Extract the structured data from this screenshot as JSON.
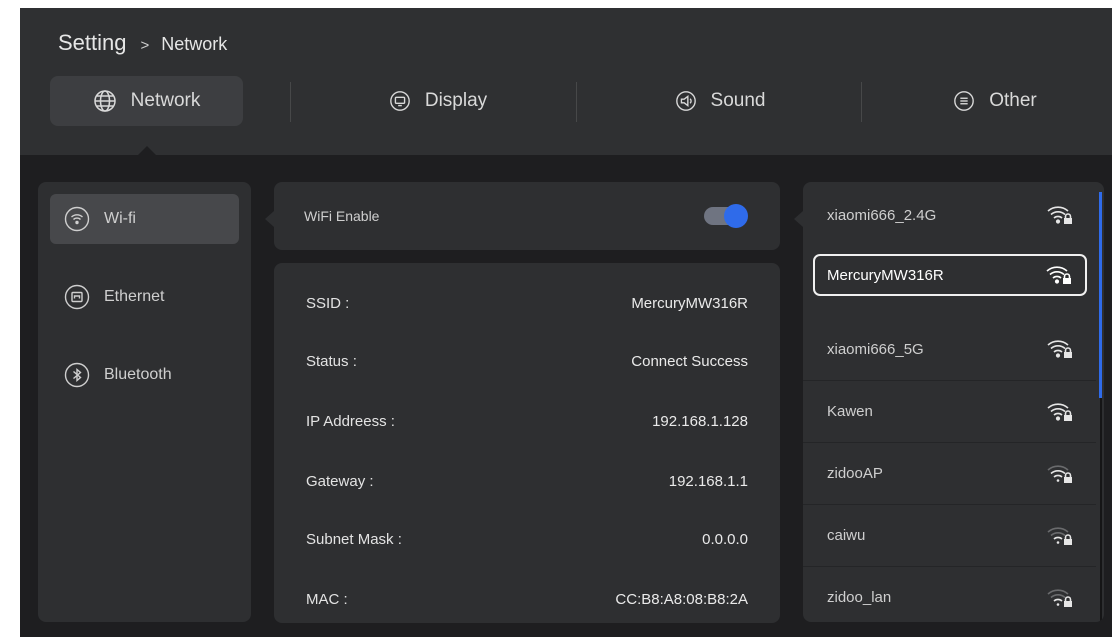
{
  "breadcrumb": {
    "root": "Setting",
    "separator": ">",
    "current": "Network"
  },
  "tabs": [
    {
      "label": "Network",
      "icon": "globe-icon"
    },
    {
      "label": "Display",
      "icon": "display-icon"
    },
    {
      "label": "Sound",
      "icon": "speaker-icon"
    },
    {
      "label": "Other",
      "icon": "menu-icon"
    }
  ],
  "sidebar": {
    "items": [
      {
        "label": "Wi-fi",
        "icon": "wifi-icon"
      },
      {
        "label": "Ethernet",
        "icon": "ethernet-icon"
      },
      {
        "label": "Bluetooth",
        "icon": "bluetooth-icon"
      }
    ]
  },
  "wifi_enable": {
    "label": "WiFi Enable",
    "state": "on"
  },
  "details": [
    {
      "key": "SSID :",
      "value": "MercuryMW316R"
    },
    {
      "key": "Status :",
      "value": "Connect Success"
    },
    {
      "key": "IP Addreess :",
      "value": "192.168.1.128"
    },
    {
      "key": "Gateway :",
      "value": "192.168.1.1"
    },
    {
      "key": "Subnet Mask :",
      "value": "0.0.0.0"
    },
    {
      "key": "MAC :",
      "value": "CC:B8:A8:08:B8:2A"
    }
  ],
  "networks": [
    {
      "ssid": "xiaomi666_2.4G",
      "signal": 4
    },
    {
      "ssid": "MercuryMW316R",
      "signal": 4,
      "selected": true
    },
    {
      "ssid": "xiaomi666_5G",
      "signal": 4
    },
    {
      "ssid": "Kawen",
      "signal": 4
    },
    {
      "ssid": "zidooAP",
      "signal": 3
    },
    {
      "ssid": "caiwu",
      "signal": 2
    },
    {
      "ssid": "zidoo_lan",
      "signal": 2
    }
  ],
  "colors": {
    "accent": "#2f6bea",
    "background": "#1e1e20",
    "header": "#2f3032",
    "panel": "#2e2f31"
  }
}
